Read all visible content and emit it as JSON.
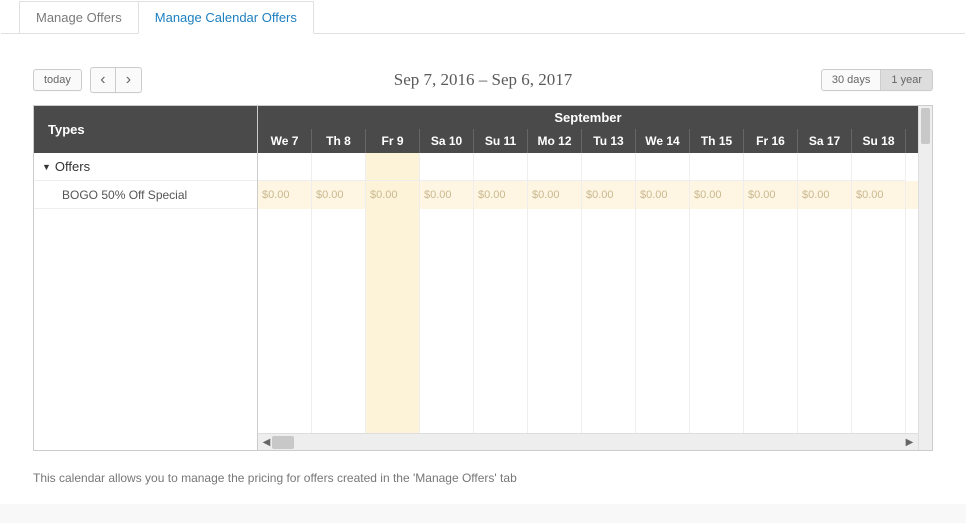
{
  "tabs": [
    {
      "label": "Manage Offers",
      "active": false
    },
    {
      "label": "Manage Calendar Offers",
      "active": true
    }
  ],
  "toolbar": {
    "today_label": "today",
    "prev_glyph": "‹",
    "next_glyph": "›",
    "range_title": "Sep 7, 2016 – Sep 6, 2017",
    "view_30": "30 days",
    "view_1y": "1 year"
  },
  "left": {
    "header": "Types",
    "group_label": "Offers",
    "item_label": "BOGO 50% Off Special"
  },
  "month_header": "September",
  "days": [
    "We 7",
    "Th 8",
    "Fr 9",
    "Sa 10",
    "Su 11",
    "Mo 12",
    "Tu 13",
    "We 14",
    "Th 15",
    "Fr 16",
    "Sa 17",
    "Su 18"
  ],
  "values": [
    "$0.00",
    "$0.00",
    "$0.00",
    "$0.00",
    "$0.00",
    "$0.00",
    "$0.00",
    "$0.00",
    "$0.00",
    "$0.00",
    "$0.00",
    "$0.00"
  ],
  "highlight_index": 2,
  "footer": "This calendar allows you to manage the pricing for offers created in the 'Manage Offers' tab"
}
